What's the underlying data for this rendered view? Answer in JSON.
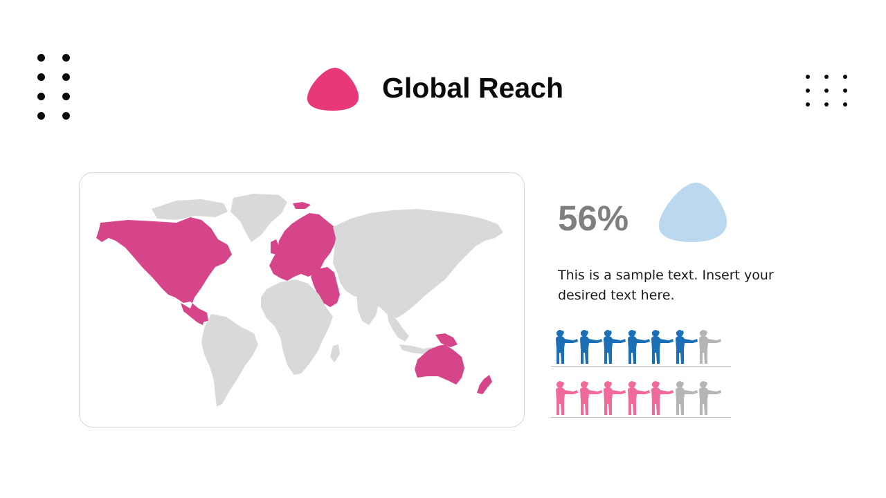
{
  "slide": {
    "title": "Global Reach"
  },
  "colors": {
    "accent_pink": "#e8387a",
    "map_highlight": "#d6458a",
    "map_base": "#d9d9d9",
    "stat_blob": "#bcd8ee",
    "people_blue": "#1c6fb5",
    "people_pink": "#f06a9c",
    "people_gray": "#b5b5b5"
  },
  "map": {
    "highlighted_regions": [
      "north-america",
      "europe",
      "middle-east",
      "australia",
      "new-zealand",
      "papua-new-guinea"
    ]
  },
  "stat": {
    "value": "56%",
    "description": "This is a sample text. Insert your desired text here."
  },
  "pictograph": {
    "rows": [
      {
        "color": "people_blue",
        "filled": 6,
        "total": 7
      },
      {
        "color": "people_pink",
        "filled": 5,
        "total": 7
      }
    ]
  },
  "icons": {
    "title_blob": "blob-shape",
    "stat_blob": "blob-shape",
    "person": "pointing-person-icon",
    "decor_left": "dot-grid",
    "decor_right": "dot-grid"
  }
}
